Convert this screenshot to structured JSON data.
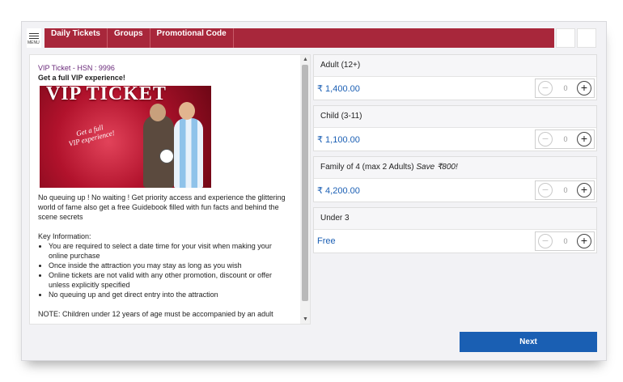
{
  "menu": {
    "label": "MENU"
  },
  "nav": {
    "tabs": [
      {
        "label": "Daily Tickets"
      },
      {
        "label": "Groups"
      },
      {
        "label": "Promotional Code"
      }
    ]
  },
  "description": {
    "hsn": "VIP Ticket - HSN : 9996",
    "subtitle": "Get a full VIP experience!",
    "image": {
      "title": "VIP TICKET",
      "badge_line1": "Get a full",
      "badge_line2": "VIP experience!"
    },
    "intro": "No queuing up ! No waiting ! Get priority access and experience the glittering world of fame also get a free Guidebook filled with fun facts and behind the scene secrets",
    "key_info_title": "Key Information:",
    "key_info": [
      "You are required to select a date time for your visit when making your online purchase",
      "Once inside the attraction you may stay as long as you wish",
      "Online tickets are not valid with any other promotion, discount or offer unless explicitly specified",
      "No queuing up and get direct entry into the attraction"
    ],
    "note": "NOTE: Children under 12 years of age must be accompanied by an adult"
  },
  "tickets": [
    {
      "name": "Adult (12+)",
      "save": "",
      "price": "₹ 1,400.00",
      "qty": "0"
    },
    {
      "name": "Child (3-11)",
      "save": "",
      "price": "₹ 1,100.00",
      "qty": "0"
    },
    {
      "name": "Family of 4 (max 2 Adults)",
      "save": "Save ₹800!",
      "price": "₹ 4,200.00",
      "qty": "0"
    },
    {
      "name": "Under 3",
      "save": "",
      "price": "Free",
      "qty": "0"
    }
  ],
  "next_label": "Next",
  "colors": {
    "nav": "#a8273b",
    "price": "#1b5fb4",
    "next_button": "#1a5fb3",
    "hsn": "#6a2a7a"
  }
}
